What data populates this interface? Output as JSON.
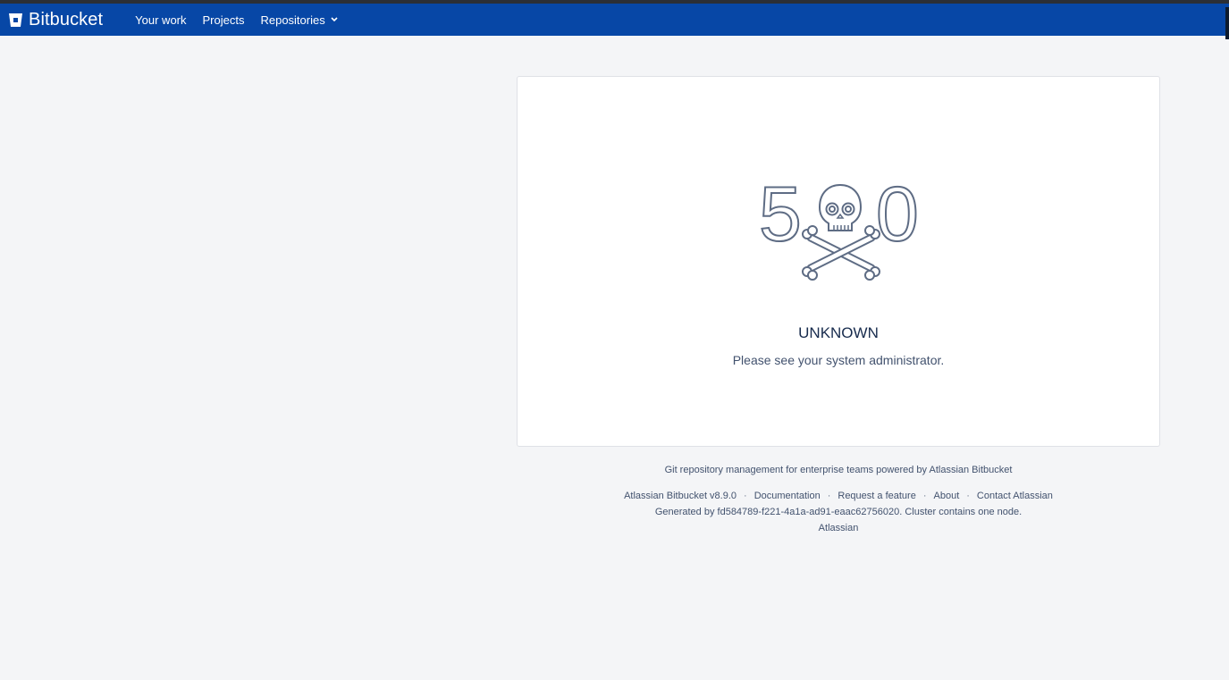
{
  "app": {
    "name": "Bitbucket",
    "logo_icon": "bitbucket-bucket-icon"
  },
  "nav": {
    "items": [
      {
        "label": "Your work"
      },
      {
        "label": "Projects"
      },
      {
        "label": "Repositories",
        "icon": "chevron-down-icon"
      }
    ]
  },
  "error": {
    "code_left": "5",
    "code_right": "0",
    "illustration_icon": "skull-and-crossbones-icon",
    "title": "UNKNOWN",
    "message": "Please see your system administrator."
  },
  "footer": {
    "tagline": "Git repository management for enterprise teams powered by Atlassian Bitbucket",
    "links": [
      "Atlassian Bitbucket v8.9.0",
      "Documentation",
      "Request a feature",
      "About",
      "Contact Atlassian"
    ],
    "separator": "·",
    "generated": "Generated by fd584789-f221-4a1a-ad91-eaac62756020. Cluster contains one node.",
    "brand": "Atlassian"
  },
  "colors": {
    "header_bg": "#0747a6",
    "page_bg": "#f4f5f7",
    "card_bg": "#ffffff",
    "text_primary": "#172b4d",
    "text_secondary": "#42526e"
  }
}
